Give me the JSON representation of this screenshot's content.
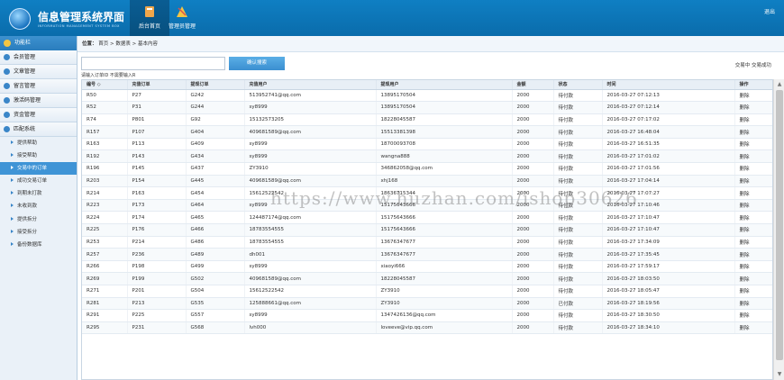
{
  "header": {
    "title": "信息管理系统界面",
    "subtitle": "INFORMATION MANAGEMENT SYSTEM BOX",
    "tabs": [
      {
        "label": "后台首页"
      },
      {
        "label": "管理员管理"
      }
    ],
    "logout": "退出"
  },
  "sidebar": {
    "title": "功能栏",
    "groups": [
      {
        "label": "会员管理"
      },
      {
        "label": "文章管理"
      },
      {
        "label": "留言管理"
      },
      {
        "label": "激活码管理"
      },
      {
        "label": "资金管理"
      },
      {
        "label": "匹配系统"
      }
    ],
    "items": [
      {
        "label": "提供帮助"
      },
      {
        "label": "接受帮助"
      },
      {
        "label": "交易中的订单"
      },
      {
        "label": "成功交易订单"
      },
      {
        "label": "到期未打款"
      },
      {
        "label": "未收到款"
      },
      {
        "label": "提供拆分"
      },
      {
        "label": "接受拆分"
      },
      {
        "label": "备份数据库"
      }
    ]
  },
  "breadcrumb": {
    "prefix": "位置：",
    "path": "首页 > 数据表 > 基本内容"
  },
  "toolbar": {
    "search_value": "",
    "search_button": "确认搜索",
    "hint": "请输入订单ID 不需要输入R",
    "status_links": "交易中 交易成功"
  },
  "table": {
    "columns": [
      "编号 ◇",
      "充值订单",
      "提现订单",
      "充值用户",
      "提现用户",
      "金额",
      "状态",
      "时间",
      "操作"
    ],
    "rows": [
      [
        "R50",
        "P27",
        "G242",
        "513952741@qq.com",
        "13895170504",
        "2000",
        "待付款",
        "2016-03-27 07:12:13",
        "删除"
      ],
      [
        "R52",
        "P31",
        "G244",
        "sy8999",
        "13895170504",
        "2000",
        "待付款",
        "2016-03-27 07:12:14",
        "删除"
      ],
      [
        "R74",
        "P801",
        "G92",
        "15132573205",
        "18228045587",
        "2000",
        "待付款",
        "2016-03-27 07:17:02",
        "删除"
      ],
      [
        "R157",
        "P107",
        "G404",
        "409681589@qq.com",
        "15513381398",
        "2000",
        "待付款",
        "2016-03-27 16:48:04",
        "删除"
      ],
      [
        "R163",
        "P113",
        "G409",
        "sy8999",
        "18700093708",
        "2000",
        "待付款",
        "2016-03-27 16:51:35",
        "删除"
      ],
      [
        "R192",
        "P143",
        "G434",
        "sy8999",
        "wangna888",
        "2000",
        "待付款",
        "2016-03-27 17:01:02",
        "删除"
      ],
      [
        "R196",
        "P145",
        "G437",
        "ZY3910",
        "346862058@qq.com",
        "2000",
        "待付款",
        "2016-03-27 17:01:56",
        "删除"
      ],
      [
        "R203",
        "P154",
        "G445",
        "409681589@qq.com",
        "xhj168",
        "2000",
        "待付款",
        "2016-03-27 17:04:14",
        "删除"
      ],
      [
        "R214",
        "P163",
        "G454",
        "15612522542",
        "18636715344",
        "2000",
        "待付款",
        "2016-03-27 17:07:27",
        "删除"
      ],
      [
        "R223",
        "P173",
        "G464",
        "sy8999",
        "15175643666",
        "2000",
        "待付款",
        "2016-03-27 17:10:46",
        "删除"
      ],
      [
        "R224",
        "P174",
        "G465",
        "124487174@qq.com",
        "15175643666",
        "2000",
        "待付款",
        "2016-03-27 17:10:47",
        "删除"
      ],
      [
        "R225",
        "P176",
        "G466",
        "18783554555",
        "15175643666",
        "2000",
        "待付款",
        "2016-03-27 17:10:47",
        "删除"
      ],
      [
        "R253",
        "P214",
        "G486",
        "18783554555",
        "13676347677",
        "2000",
        "待付款",
        "2016-03-27 17:34:09",
        "删除"
      ],
      [
        "R257",
        "P236",
        "G489",
        "dh001",
        "13676347677",
        "2000",
        "待付款",
        "2016-03-27 17:35:45",
        "删除"
      ],
      [
        "R266",
        "P198",
        "G499",
        "sy8999",
        "xiaoyi666",
        "2000",
        "待付款",
        "2016-03-27 17:59:17",
        "删除"
      ],
      [
        "R269",
        "P199",
        "G502",
        "409681589@qq.com",
        "18228045587",
        "2000",
        "待付款",
        "2016-03-27 18:03:50",
        "删除"
      ],
      [
        "R271",
        "P201",
        "G504",
        "15612522542",
        "ZY3910",
        "2000",
        "待付款",
        "2016-03-27 18:05:47",
        "删除"
      ],
      [
        "R281",
        "P213",
        "G535",
        "125888661@qq.com",
        "ZY3910",
        "2000",
        "已付款",
        "2016-03-27 18:19:56",
        "删除"
      ],
      [
        "R291",
        "P225",
        "G557",
        "sy8999",
        "1347426136@qq.com",
        "2000",
        "待付款",
        "2016-03-27 18:30:50",
        "删除"
      ],
      [
        "R295",
        "P231",
        "G568",
        "lvh000",
        "loveeve@vip.qq.com",
        "2000",
        "待付款",
        "2016-03-27 18:34:10",
        "删除"
      ]
    ]
  },
  "watermark": "https://www.huzhan.com/ishop30626",
  "colors": {
    "header_blue": "#0f7fc3",
    "active_blue": "#3f94d6"
  }
}
